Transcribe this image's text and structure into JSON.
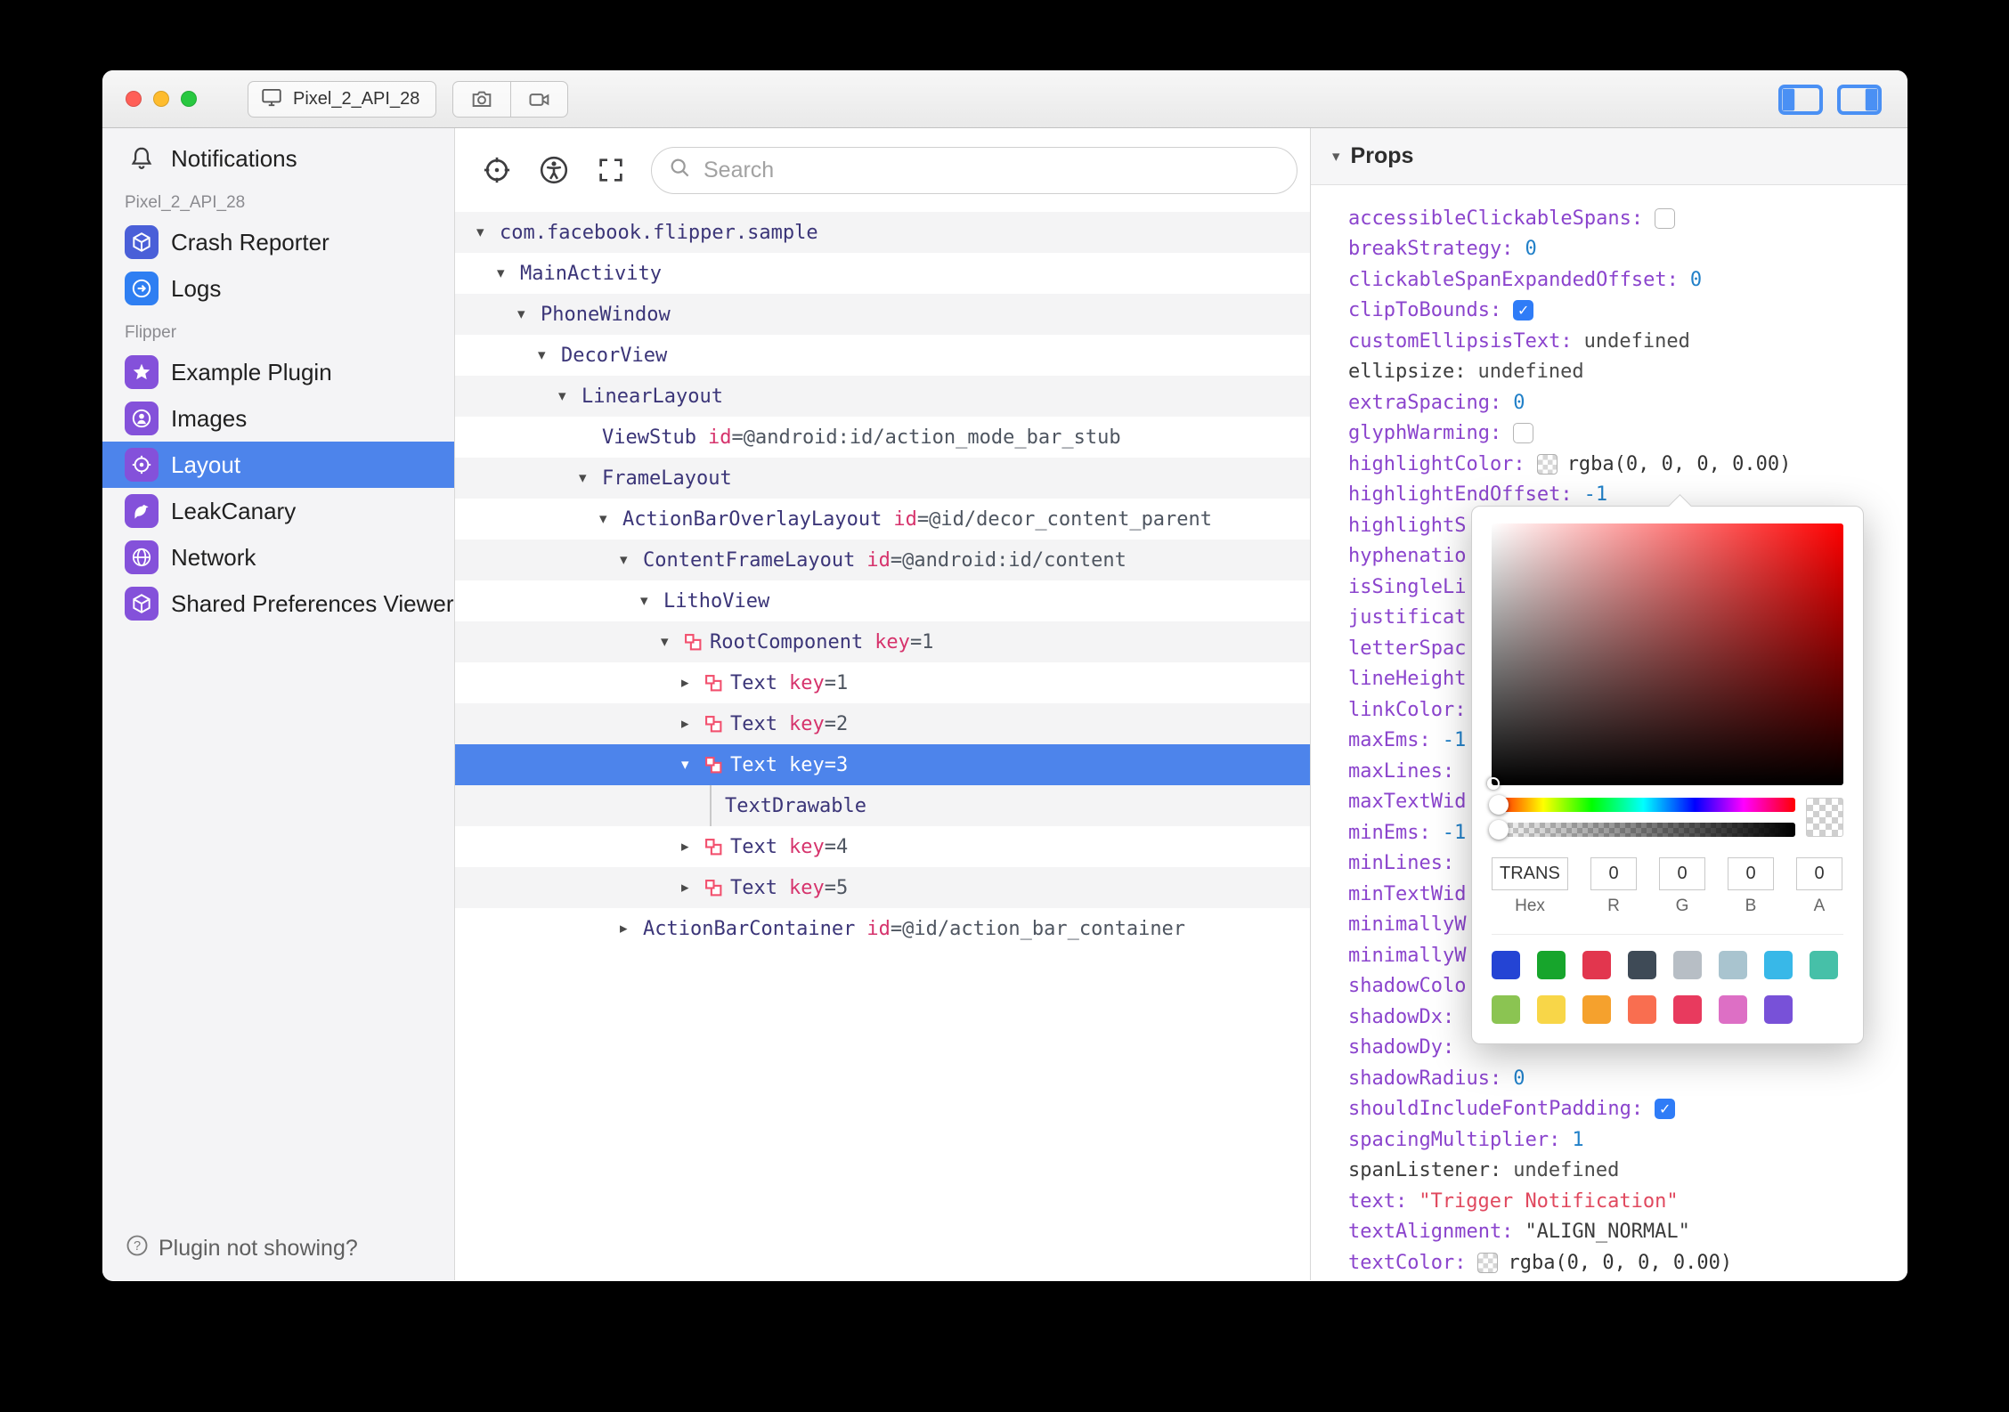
{
  "titlebar": {
    "device_label": "Pixel_2_API_28",
    "window_buttons": [
      "close",
      "minimize",
      "zoom"
    ]
  },
  "sidebar": {
    "notifications": {
      "label": "Notifications",
      "icon": "bell-icon"
    },
    "sections": [
      {
        "label": "Pixel_2_API_28",
        "items": [
          {
            "label": "Crash Reporter",
            "icon": "cube-icon",
            "icon_color": "#4a5fd8",
            "selected": false
          },
          {
            "label": "Logs",
            "icon": "arrow-right-circle-icon",
            "icon_color": "#2f7ff2",
            "selected": false
          }
        ]
      },
      {
        "label": "Flipper",
        "items": [
          {
            "label": "Example Plugin",
            "icon": "star-icon",
            "icon_color": "#8451da",
            "selected": false
          },
          {
            "label": "Images",
            "icon": "profile-icon",
            "icon_color": "#8451da",
            "selected": false
          },
          {
            "label": "Layout",
            "icon": "target-icon",
            "icon_color": "#8451da",
            "selected": true
          },
          {
            "label": "LeakCanary",
            "icon": "bird-icon",
            "icon_color": "#8451da",
            "selected": false
          },
          {
            "label": "Network",
            "icon": "globe-icon",
            "icon_color": "#8451da",
            "selected": false
          },
          {
            "label": "Shared Preferences Viewer",
            "icon": "cube-icon",
            "icon_color": "#8451da",
            "selected": false
          }
        ]
      }
    ],
    "footer": {
      "label": "Plugin not showing?",
      "icon": "help-circle-icon"
    }
  },
  "inspector": {
    "search_placeholder": "Search",
    "toolbar_icons": [
      "crosshair-icon",
      "accessibility-icon",
      "expand-icon"
    ],
    "tree": [
      {
        "depth": 0,
        "chevron": "down",
        "name": "com.facebook.flipper.sample"
      },
      {
        "depth": 1,
        "chevron": "down",
        "name": "MainActivity"
      },
      {
        "depth": 2,
        "chevron": "down",
        "name": "PhoneWindow"
      },
      {
        "depth": 3,
        "chevron": "down",
        "name": "DecorView"
      },
      {
        "depth": 4,
        "chevron": "down",
        "name": "LinearLayout"
      },
      {
        "depth": 5,
        "chevron": "none",
        "name": "ViewStub",
        "attr_key": "id",
        "attr_value": "=@android:id/action_mode_bar_stub"
      },
      {
        "depth": 5,
        "chevron": "down",
        "name": "FrameLayout"
      },
      {
        "depth": 6,
        "chevron": "down",
        "name": "ActionBarOverlayLayout",
        "attr_key": "id",
        "attr_value": "=@id/decor_content_parent"
      },
      {
        "depth": 7,
        "chevron": "down",
        "name": "ContentFrameLayout",
        "attr_key": "id",
        "attr_value": "=@android:id/content"
      },
      {
        "depth": 8,
        "chevron": "down",
        "name": "LithoView"
      },
      {
        "depth": 9,
        "chevron": "down",
        "litho": true,
        "name": "RootComponent",
        "attr_key": "key",
        "attr_value": "=1"
      },
      {
        "depth": 10,
        "chevron": "right",
        "litho": true,
        "name": "Text",
        "attr_key": "key",
        "attr_value": "=1"
      },
      {
        "depth": 10,
        "chevron": "right",
        "litho": true,
        "name": "Text",
        "attr_key": "key",
        "attr_value": "=2"
      },
      {
        "depth": 10,
        "chevron": "down",
        "litho": true,
        "name": "Text",
        "attr_key": "key",
        "attr_value": "=3",
        "selected": true
      },
      {
        "depth": 11,
        "chevron": "line",
        "name": "TextDrawable"
      },
      {
        "depth": 10,
        "chevron": "right",
        "litho": true,
        "name": "Text",
        "attr_key": "key",
        "attr_value": "=4"
      },
      {
        "depth": 10,
        "chevron": "right",
        "litho": true,
        "name": "Text",
        "attr_key": "key",
        "attr_value": "=5"
      },
      {
        "depth": 7,
        "chevron": "right",
        "name": "ActionBarContainer",
        "attr_key": "id",
        "attr_value": "=@id/action_bar_container"
      }
    ]
  },
  "props": {
    "header": "Props",
    "rows": [
      {
        "name": "accessibleClickableSpans",
        "type": "checkbox",
        "checked": false
      },
      {
        "name": "breakStrategy",
        "type": "number",
        "value": "0"
      },
      {
        "name": "clickableSpanExpandedOffset",
        "type": "number",
        "value": "0"
      },
      {
        "name": "clipToBounds",
        "type": "checkbox",
        "checked": true
      },
      {
        "name": "customEllipsisText",
        "type": "plain",
        "value": "undefined"
      },
      {
        "name": "ellipsize",
        "type": "plain",
        "value": "undefined",
        "dark_name": true
      },
      {
        "name": "extraSpacing",
        "type": "number",
        "value": "0"
      },
      {
        "name": "glyphWarming",
        "type": "checkbox",
        "checked": false
      },
      {
        "name": "highlightColor",
        "type": "color",
        "value": "rgba(0, 0, 0, 0.00)"
      },
      {
        "name": "highlightEndOffset",
        "type": "number",
        "value": "-1"
      },
      {
        "name": "highlightS",
        "type": "cut"
      },
      {
        "name": "hyphenatio",
        "type": "cut"
      },
      {
        "name": "isSingleLi",
        "type": "cut"
      },
      {
        "name": "justificat",
        "type": "cut"
      },
      {
        "name": "letterSpac",
        "type": "cut"
      },
      {
        "name": "lineHeight",
        "type": "cut"
      },
      {
        "name": "linkColor",
        "type": "cut",
        "colon": true
      },
      {
        "name": "maxEms",
        "type": "number",
        "value": "-1"
      },
      {
        "name": "maxLines",
        "type": "cut",
        "colon": true
      },
      {
        "name": "maxTextWid",
        "type": "cut"
      },
      {
        "name": "minEms",
        "type": "number",
        "value": "-1"
      },
      {
        "name": "minLines",
        "type": "cut",
        "colon": true
      },
      {
        "name": "minTextWid",
        "type": "cut"
      },
      {
        "name": "minimallyW",
        "type": "cut"
      },
      {
        "name": "minimallyW",
        "type": "cut"
      },
      {
        "name": "shadowColo",
        "type": "cut"
      },
      {
        "name": "shadowDx",
        "type": "cut",
        "colon": true
      },
      {
        "name": "shadowDy",
        "type": "cut",
        "colon": true
      },
      {
        "name": "shadowRadius",
        "type": "number",
        "value": "0"
      },
      {
        "name": "shouldIncludeFontPadding",
        "type": "checkbox",
        "checked": true
      },
      {
        "name": "spacingMultiplier",
        "type": "number",
        "value": "1"
      },
      {
        "name": "spanListener",
        "type": "plain",
        "value": "undefined",
        "dark_name": true
      },
      {
        "name": "text",
        "type": "string",
        "value": "\"Trigger Notification\""
      },
      {
        "name": "textAlignment",
        "type": "string_dark",
        "value": "\"ALIGN_NORMAL\""
      },
      {
        "name": "textColor",
        "type": "color",
        "value": "rgba(0, 0, 0, 0.00)"
      }
    ]
  },
  "color_picker": {
    "hex": "TRANS",
    "r": "0",
    "g": "0",
    "b": "0",
    "a": "0",
    "labels": {
      "hex": "Hex",
      "r": "R",
      "g": "G",
      "b": "B",
      "a": "A"
    },
    "swatches": [
      [
        "#2444d4",
        "#17a52c",
        "#e2364e",
        "#3e4a56",
        "#b7bec5",
        "#a9c4cf",
        "#38b8e8",
        "#46c0a8"
      ],
      [
        "#8bc452",
        "#f8d648",
        "#f5a12d",
        "#f96e50",
        "#e83a5e",
        "#dd6fc5",
        "#7851d8"
      ]
    ]
  }
}
